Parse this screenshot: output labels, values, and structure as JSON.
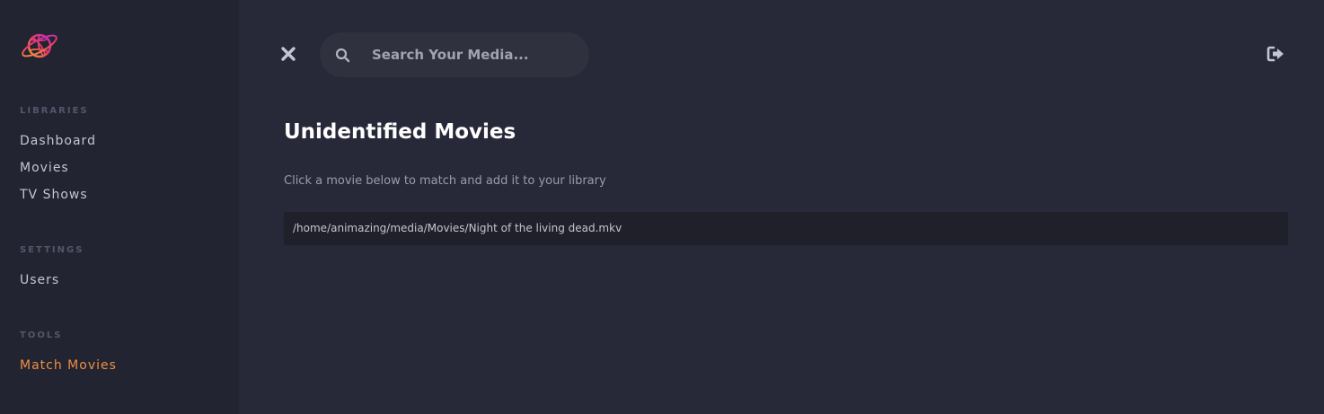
{
  "sidebar": {
    "sections": [
      {
        "title": "LIBRARIES",
        "items": [
          {
            "label": "Dashboard"
          },
          {
            "label": "Movies"
          },
          {
            "label": "TV Shows"
          }
        ]
      },
      {
        "title": "SETTINGS",
        "items": [
          {
            "label": "Users"
          }
        ]
      },
      {
        "title": "TOOLS",
        "items": [
          {
            "label": "Match Movies",
            "active": true
          }
        ]
      }
    ]
  },
  "header": {
    "search": {
      "placeholder": "Search Your Media...",
      "value": ""
    },
    "icons": {
      "close": "close-icon",
      "search": "search-icon",
      "logout": "sign-out-icon"
    }
  },
  "main": {
    "title": "Unidentified Movies",
    "description": "Click a movie below to match and add it to your library",
    "movies": [
      {
        "path": "/home/animazing/media/Movies/Night of the living dead.mkv"
      }
    ]
  },
  "colors": {
    "background": "#272838",
    "sidebar": "#232431",
    "accent": "#ee8f44",
    "row": "#1f2029"
  }
}
